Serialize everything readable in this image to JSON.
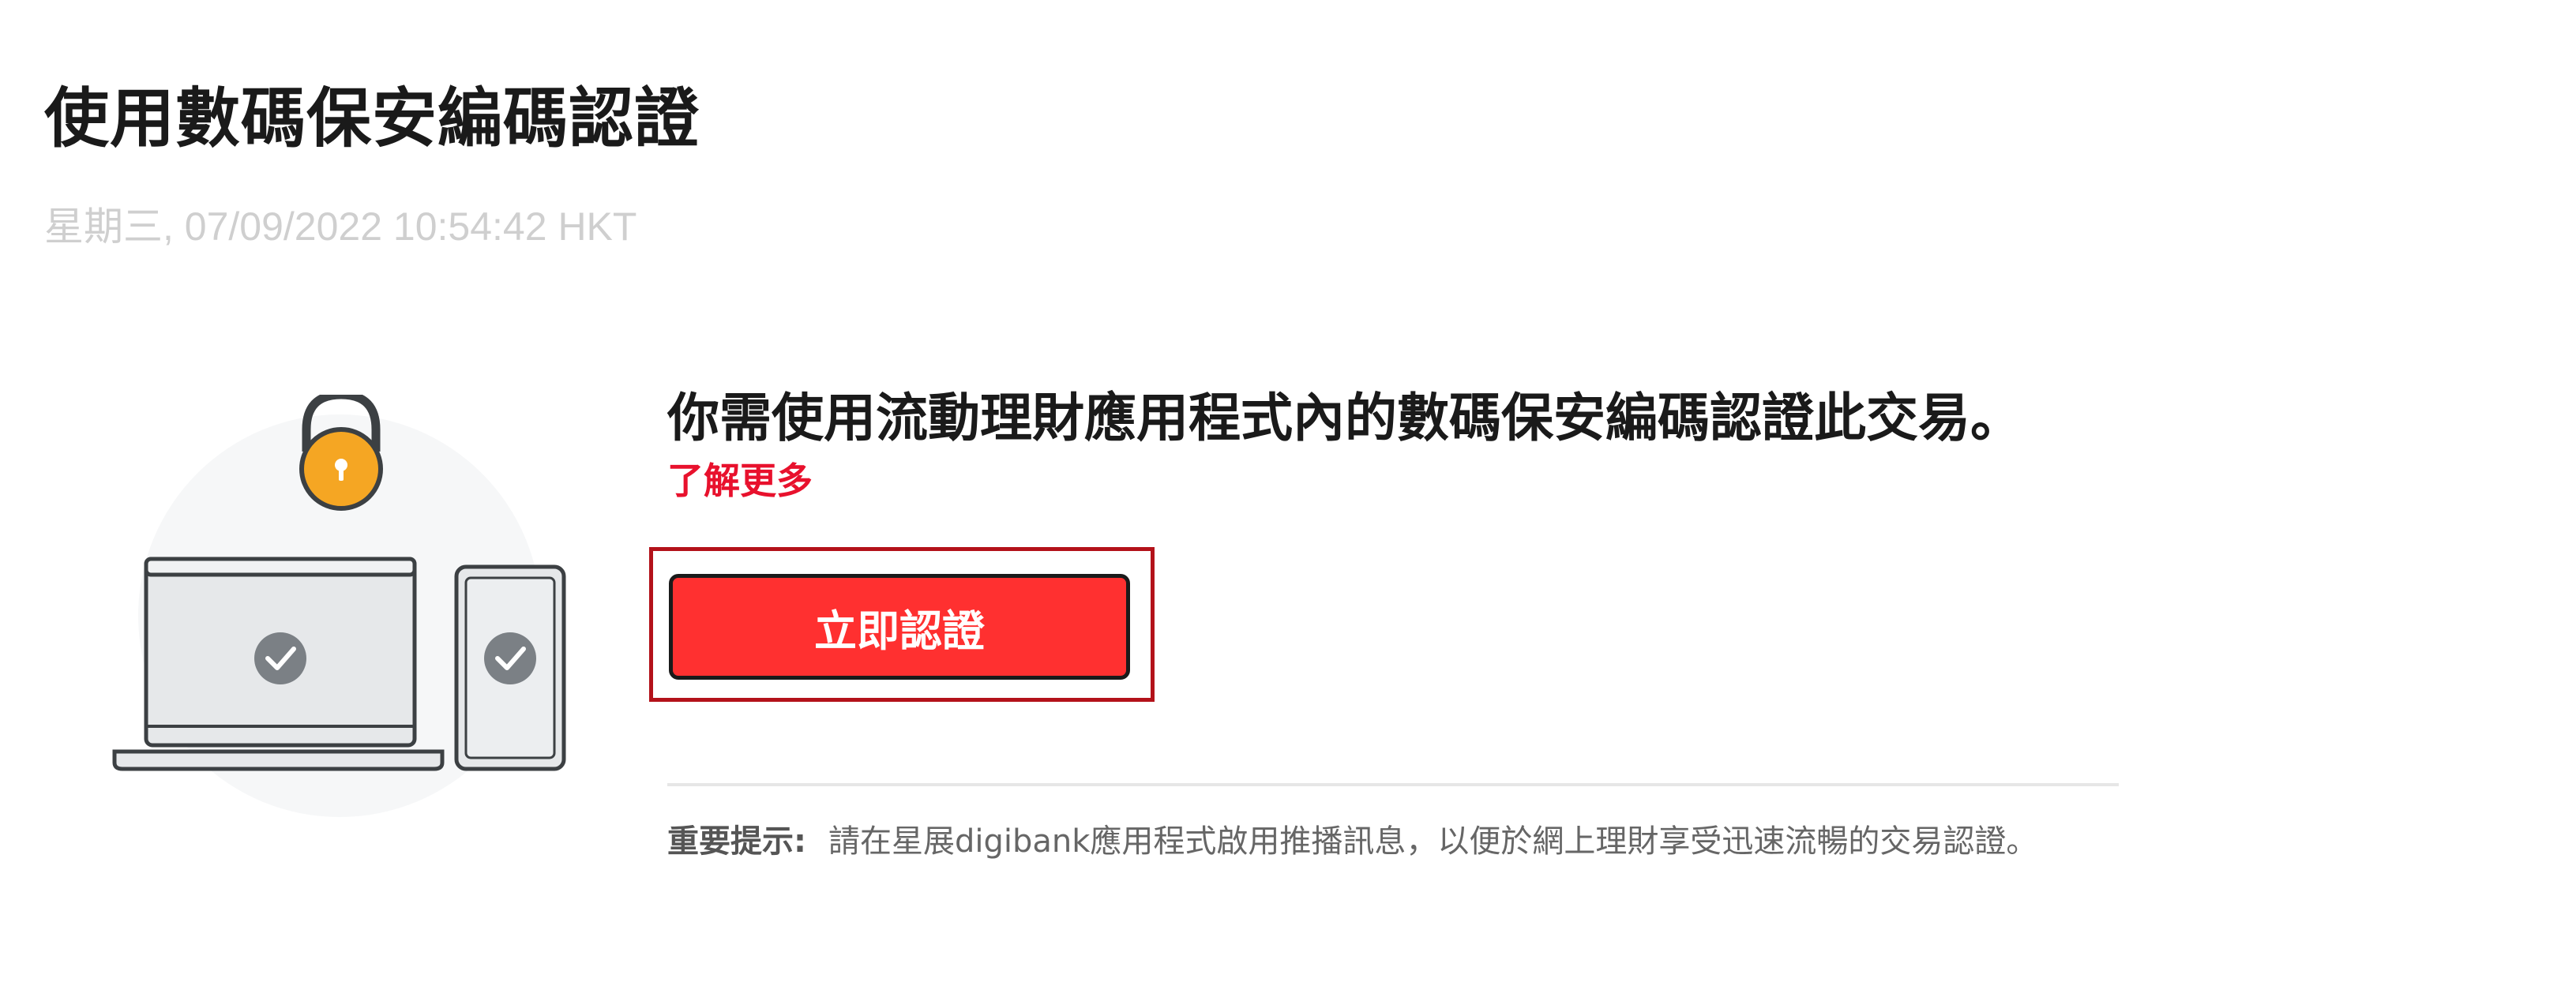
{
  "header": {
    "title": "使用數碼保安編碼認證",
    "timestamp": "星期三, 07/09/2022 10:54:42 HKT"
  },
  "main": {
    "message": "你需使用流動理財應用程式內的數碼保安編碼認證此交易。",
    "learn_more_label": "了解更多",
    "authenticate_button_label": "立即認證"
  },
  "notice": {
    "label": "重要提示:",
    "text": "請在星展digibank應用程式啟用推播訊息，以便於網上理財享受迅速流暢的交易認證。"
  },
  "colors": {
    "accent_red": "#e8112d",
    "button_red": "#ff3030",
    "lock_orange": "#f5a623",
    "timestamp_gray": "#cfcfcf"
  },
  "icons": {
    "illustration": "laptop-phone-lock-illustration",
    "check": "check-icon",
    "lock": "padlock-icon"
  }
}
